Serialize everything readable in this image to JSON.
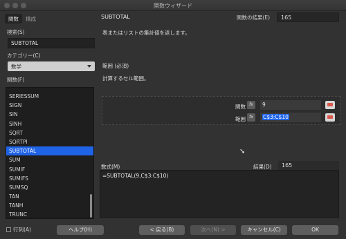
{
  "window": {
    "title": "関数ウィザード"
  },
  "tabs": [
    {
      "label": "関数"
    },
    {
      "label": "構成"
    }
  ],
  "search": {
    "label": "検索(S)",
    "value": "SUBTOTAL"
  },
  "category": {
    "label": "カテゴリー(C)",
    "selected": "数学"
  },
  "functions": {
    "label": "関数(F)",
    "items": [
      "SERIESSUM",
      "SIGN",
      "SIN",
      "SINH",
      "SQRT",
      "SQRTPI",
      "SUBTOTAL",
      "SUM",
      "SUMIF",
      "SUMIFS",
      "SUMSQ",
      "TAN",
      "TANH",
      "TRUNC"
    ],
    "selected": "SUBTOTAL"
  },
  "detail": {
    "function_name": "SUBTOTAL",
    "result_label": "関数の結果(E)",
    "result_value": "165",
    "description": "表またはリストの集計値を返します。",
    "argument_header": "範囲 (必須)",
    "argument_description": "計算するセル範囲。",
    "arguments": [
      {
        "name": "関数",
        "value": "9"
      },
      {
        "name": "範囲",
        "value": "C$3:C$10"
      }
    ],
    "fx_label": "fx"
  },
  "formula": {
    "label": "数式(M)",
    "value": "=SUBTOTAL(9,C$3:C$10)",
    "result_label": "結果(D)",
    "result_value": "165"
  },
  "footer": {
    "array_label": "行列(A)",
    "help": "ヘルプ(H)",
    "back": "< 戻る(B)",
    "next": "次へ(N) >",
    "cancel": "キャンセル(C)",
    "ok": "OK"
  }
}
